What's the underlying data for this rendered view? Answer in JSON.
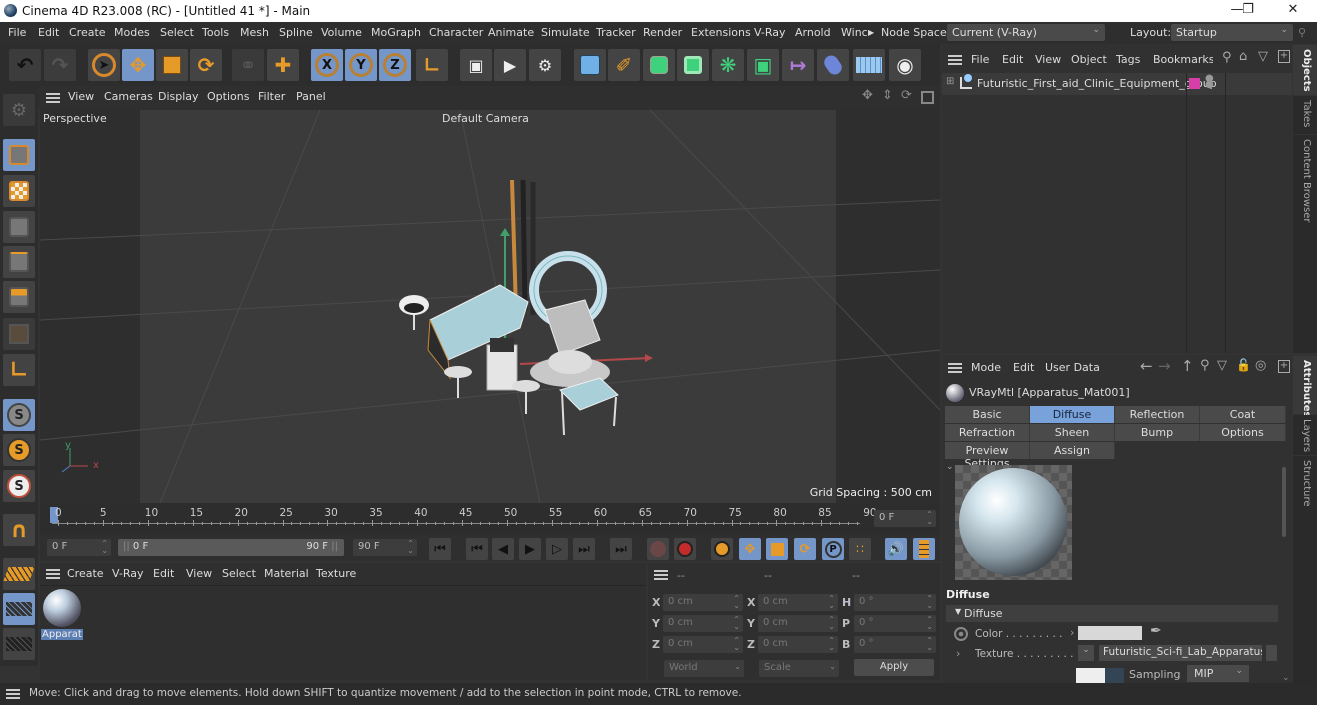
{
  "window": {
    "title": "Cinema 4D R23.008 (RC) - [Untitled 41 *] - Main",
    "minimize_icon": "minimize-icon",
    "maximize_icon": "restore-icon",
    "close_icon": "close-icon"
  },
  "menubar": {
    "items": [
      "File",
      "Edit",
      "Create",
      "Modes",
      "Select",
      "Tools",
      "Mesh",
      "Spline",
      "Volume",
      "MoGraph",
      "Character",
      "Animate",
      "Simulate",
      "Tracker",
      "Render",
      "Extensions",
      "V-Ray",
      "Arnold",
      "Winc"
    ],
    "node_space_label": "Node Space:",
    "node_space_value": "Current (V-Ray)",
    "layout_label": "Layout:",
    "layout_value": "Startup"
  },
  "toolbar": {
    "undo": "undo-icon",
    "redo": "redo-icon",
    "tools": [
      "select",
      "move",
      "scale",
      "rotate",
      "recent",
      "move-axis"
    ],
    "axis": [
      "X",
      "Y",
      "Z"
    ],
    "coord_system": "world-coordinates-icon",
    "render": [
      "render-view",
      "render-picture-viewer",
      "render-settings"
    ],
    "objects": [
      "cube",
      "pen",
      "subdivision",
      "extrude",
      "cloner",
      "mograph-array",
      "deformer",
      "field",
      "floor",
      "camera"
    ]
  },
  "viewport": {
    "menu": [
      "View",
      "Cameras",
      "Display",
      "Options",
      "Filter",
      "Panel"
    ],
    "label": "Perspective",
    "camera": "Default Camera",
    "grid_spacing": "Grid Spacing : 500 cm",
    "axis_y": "y",
    "axis_x": "x"
  },
  "timeline": {
    "ticks": [
      "0",
      "5",
      "10",
      "15",
      "20",
      "25",
      "30",
      "35",
      "40",
      "45",
      "50",
      "55",
      "60",
      "65",
      "70",
      "75",
      "80",
      "85",
      "90"
    ],
    "current_frame": "0 F",
    "start_field": "0 F",
    "range_start": "0 F",
    "range_end": "90 F",
    "end_field": "90 F"
  },
  "material_manager": {
    "menu": [
      "Create",
      "V-Ray",
      "Edit",
      "View",
      "Select",
      "Material",
      "Texture"
    ],
    "materials": [
      {
        "label": "Apparat"
      }
    ]
  },
  "coordinates": {
    "headers": [
      "--",
      "--",
      "--"
    ],
    "rows": [
      {
        "l1": "X",
        "v1": "0 cm",
        "l2": "X",
        "v2": "0 cm",
        "l3": "H",
        "v3": "0 °"
      },
      {
        "l1": "Y",
        "v1": "0 cm",
        "l2": "Y",
        "v2": "0 cm",
        "l3": "P",
        "v3": "0 °"
      },
      {
        "l1": "Z",
        "v1": "0 cm",
        "l2": "Z",
        "v2": "0 cm",
        "l3": "B",
        "v3": "0 °"
      }
    ],
    "space": "World",
    "mode": "Scale",
    "apply": "Apply"
  },
  "object_manager": {
    "menu": [
      "File",
      "Edit",
      "View",
      "Object",
      "Tags",
      "Bookmarks"
    ],
    "objects": [
      {
        "name": "Futuristic_First_aid_Clinic_Equipment_group",
        "color": "#d63fa8"
      }
    ]
  },
  "attribute_manager": {
    "menu": [
      "Mode",
      "Edit",
      "User Data"
    ],
    "material_title": "VRayMtl [Apparatus_Mat001]",
    "tabs": [
      [
        "Basic",
        "Diffuse",
        "Reflection",
        "Coat"
      ],
      [
        "Refraction",
        "Sheen",
        "Bump",
        "Options"
      ],
      [
        "Preview Settings",
        "Assign"
      ]
    ],
    "active_tab": "Diffuse",
    "section": "Diffuse",
    "group": "Diffuse",
    "color_label": "Color . . . . . . . . .",
    "color_value": "#d8d8d8",
    "texture_label": "Texture . . . . . . . . .",
    "texture_value": "Futuristic_Sci-fi_Lab_Apparatus_B",
    "sampling_label": "Sampling",
    "sampling_value": "MIP"
  },
  "side_tabs": {
    "top": [
      "Objects",
      "Takes",
      "Content Browser"
    ],
    "bottom": [
      "Attributes",
      "Layers",
      "Structure"
    ]
  },
  "statusbar": {
    "text": "Move: Click and drag to move elements. Hold down SHIFT to quantize movement / add to the selection in point mode, CTRL to remove."
  }
}
